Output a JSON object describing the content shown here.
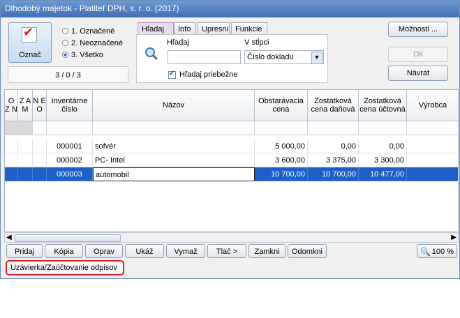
{
  "window": {
    "title": "Dlhodobý majetok - Platiteľ DPH, s. r. o. (2017)"
  },
  "mark_button": {
    "label": "Označ"
  },
  "filter_radio": {
    "options": [
      "1. Označené",
      "2. Neoznačené",
      "3. Všetko"
    ],
    "selected": "3. Všetko"
  },
  "counter": {
    "text": "3 / 0 / 3"
  },
  "tabs": [
    "Hľadaj",
    "Info",
    "Upresni",
    "Funkcie"
  ],
  "search": {
    "label": "Hľadaj",
    "column_label": "V stĺpci",
    "value": "",
    "column_value": "Číslo dokladu",
    "continuous_label": "Hľadaj priebežne",
    "continuous_checked": true
  },
  "right_buttons": {
    "options": "Možnosti ...",
    "ok": "Ok",
    "back": "Návrat"
  },
  "grid": {
    "columns": [
      "O Z N",
      "Z A M",
      "N E O",
      "Inventárne číslo",
      "Názov",
      "Obstarávacia cena",
      "Zostatková cena daňová",
      "Zostatková cena účtovná",
      "Výrobca"
    ],
    "rows": [
      {
        "inv": "000001",
        "name": "sofvér",
        "cost": "5 000,00",
        "tax": "0,00",
        "acc": "0,00"
      },
      {
        "inv": "000002",
        "name": "PC- Intel",
        "cost": "3 600,00",
        "tax": "3 375,00",
        "acc": "3 300,00"
      },
      {
        "inv": "000003",
        "name": "automobil",
        "cost": "10 700,00",
        "tax": "10 700,00",
        "acc": "10 477,00"
      }
    ]
  },
  "bottom_buttons": [
    "Pridaj",
    "Kópia",
    "Oprav",
    "Ukáž",
    "Vymaž",
    "Tlač >",
    "Zamkni",
    "Odomkni"
  ],
  "zoom": {
    "value": "100 %"
  },
  "closing": {
    "label": "Uzávierka/Zaúčtovanie odpisov"
  },
  "colors": {
    "selection": "#1e5fc8",
    "highlight_border": "#d8202a"
  }
}
